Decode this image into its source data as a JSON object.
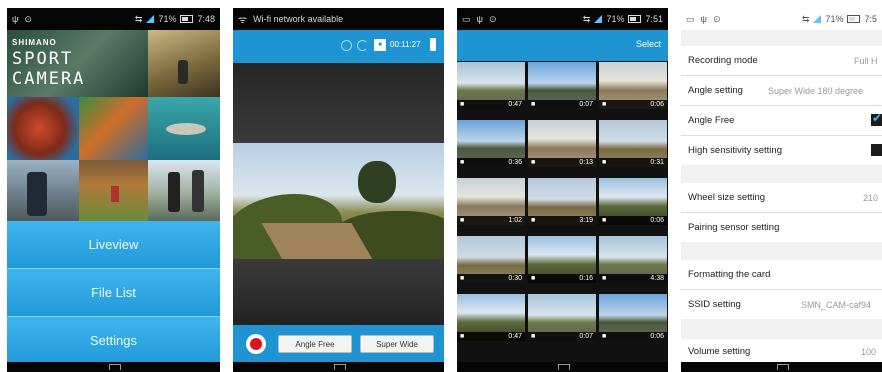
{
  "status": {
    "p1_time": "7:48",
    "p3_time": "7:51",
    "p4_time": "7:5",
    "battery_label": "71%"
  },
  "home": {
    "brand": "SHIMANO",
    "app_title_line1": "SPORT",
    "app_title_line2": "CAMERA",
    "menu": [
      "Liveview",
      "File List",
      "Settings"
    ]
  },
  "liveview": {
    "notification": "Wi-fi network available",
    "recording_time": "00:11:27",
    "angle_mode_button": "Angle Free",
    "angle_setting_button": "Super Wide"
  },
  "filelist": {
    "select_label": "Select",
    "durations": [
      "0:47",
      "0:07",
      "0:06",
      "0:36",
      "0:13",
      "0:31",
      "1:02",
      "3:19",
      "0:06",
      "0:30",
      "0:16",
      "4:38",
      "0:47",
      "0:07",
      "0:06"
    ]
  },
  "settings": {
    "rows": [
      {
        "label": "Recording mode",
        "value": "Full H"
      },
      {
        "label": "Angle setting",
        "value": "Super Wide   180 degree"
      },
      {
        "label": "Angle Free",
        "value": ""
      },
      {
        "label": "High sensitivity setting",
        "value": ""
      },
      {
        "label": "Wheel size setting",
        "value": "210"
      },
      {
        "label": "Pairing sensor setting",
        "value": ""
      },
      {
        "label": "Formatting the card",
        "value": ""
      },
      {
        "label": "SSID setting",
        "value": "SMN_CAM-caf94"
      },
      {
        "label": "Volume setting",
        "value": "100"
      }
    ]
  },
  "colors": {
    "accent_blue": "#2a9fdc",
    "record_red": "#d9141e"
  }
}
